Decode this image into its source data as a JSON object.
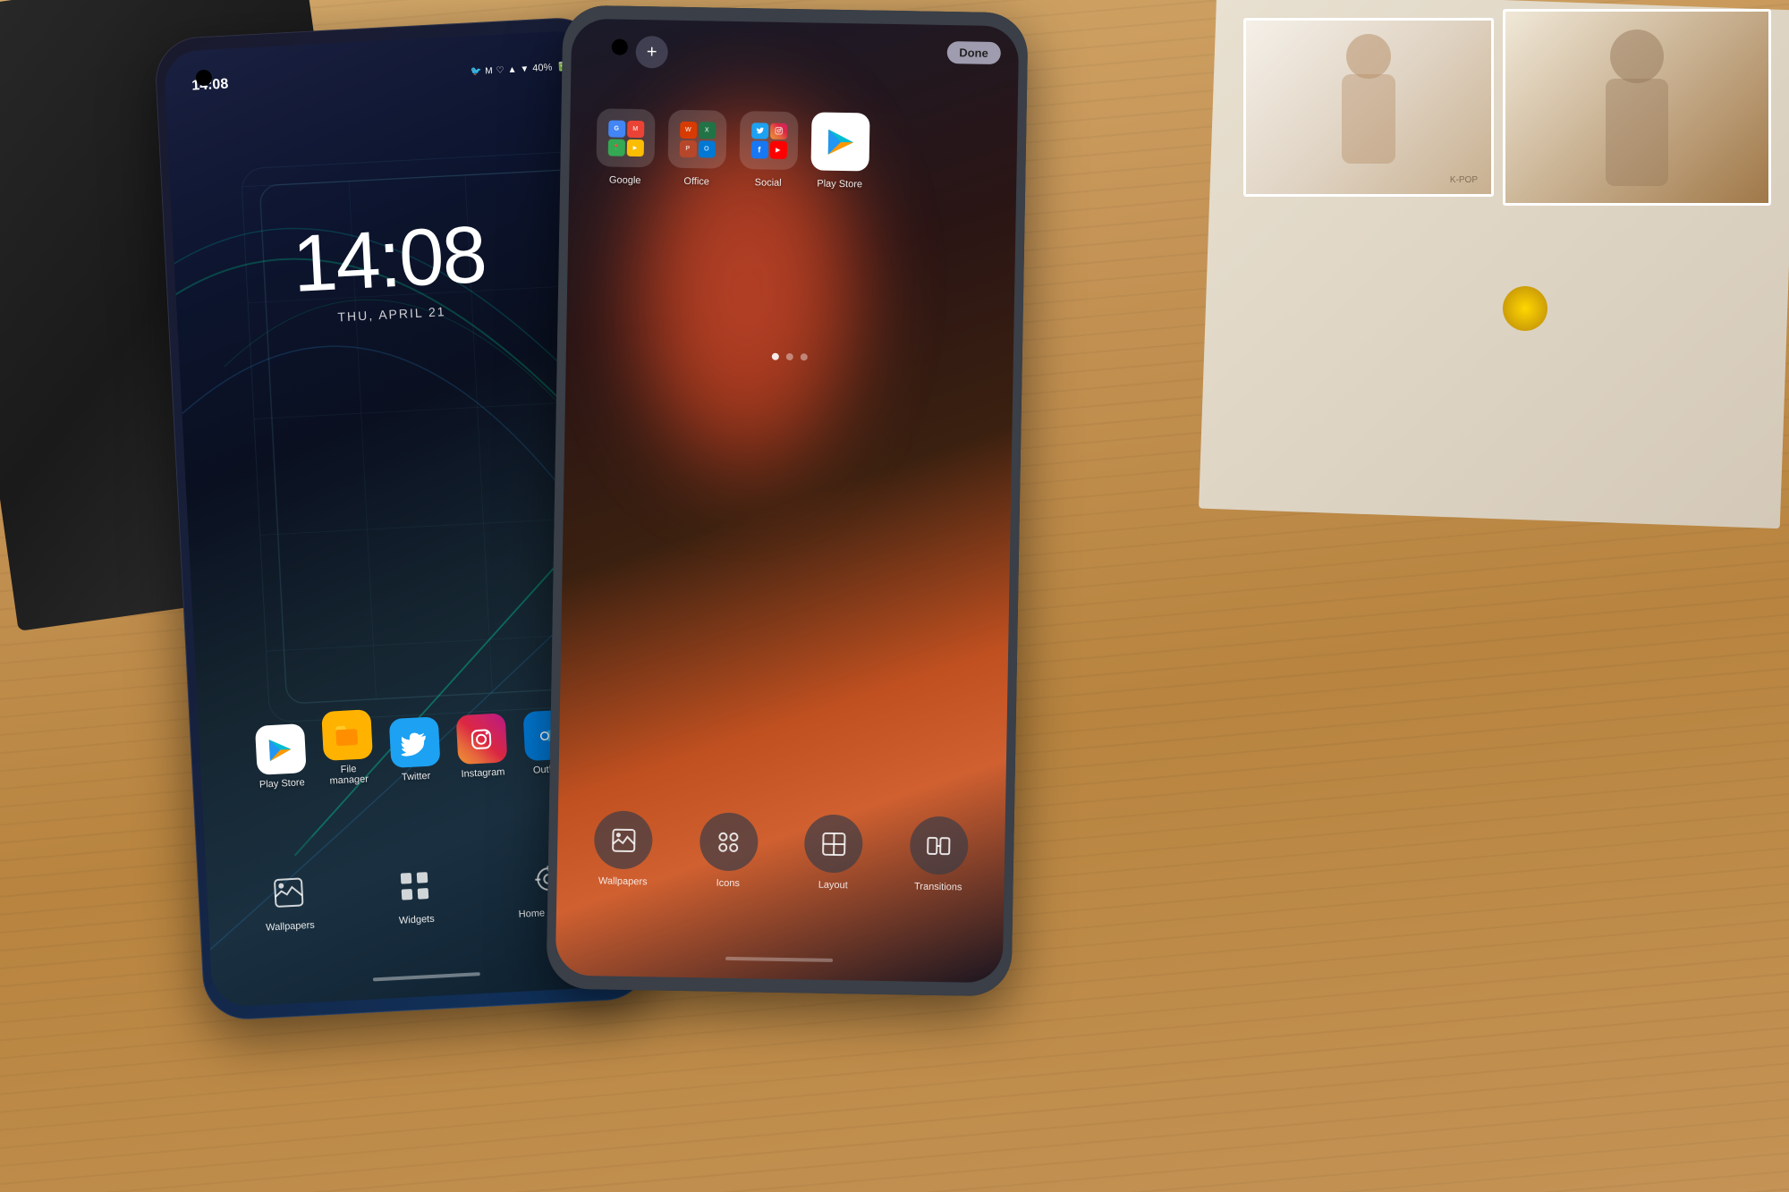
{
  "background": {
    "color": "#c49355"
  },
  "phone_left": {
    "status_bar": {
      "time": "14:08",
      "battery": "40%"
    },
    "lock_screen": {
      "time": "14:08",
      "date": "THU, APRIL 21"
    },
    "apps": [
      {
        "name": "Play Store",
        "label": "Play Store",
        "color": "#white"
      },
      {
        "name": "File Manager",
        "label": "File\nmanager",
        "color": "#FFB300"
      },
      {
        "name": "Twitter",
        "label": "Twitter",
        "color": "#1DA1F2"
      },
      {
        "name": "Instagram",
        "label": "Instagram",
        "color": "#dc2743"
      },
      {
        "name": "Outlook",
        "label": "Outlook",
        "color": "#0078D4"
      }
    ],
    "dock": [
      {
        "name": "Wallpapers",
        "label": "Wallpapers"
      },
      {
        "name": "Widgets",
        "label": "Widgets"
      },
      {
        "name": "Home settings",
        "label": "Home settings"
      }
    ]
  },
  "phone_right": {
    "done_button": "Done",
    "folders": [
      {
        "name": "Google",
        "label": "Google"
      },
      {
        "name": "Office",
        "label": "Office"
      },
      {
        "name": "Social",
        "label": "Social"
      }
    ],
    "standalone_apps": [
      {
        "name": "Play Store",
        "label": "Play Store"
      }
    ],
    "dot_indicators": [
      "active",
      "inactive",
      "inactive"
    ],
    "edit_options": [
      {
        "name": "Wallpapers",
        "label": "Wallpapers"
      },
      {
        "name": "Icons",
        "label": "Icons"
      },
      {
        "name": "Layout",
        "label": "Layout"
      },
      {
        "name": "Transitions",
        "label": "Transitions"
      }
    ]
  }
}
